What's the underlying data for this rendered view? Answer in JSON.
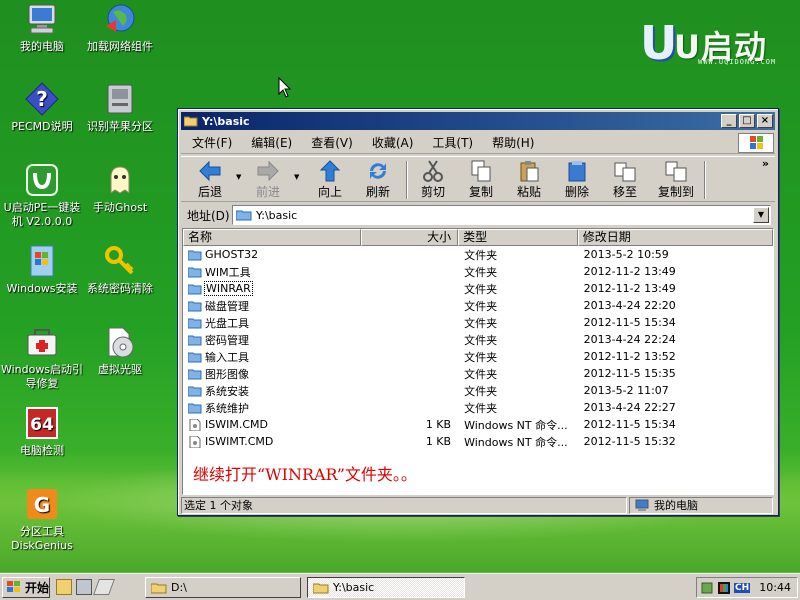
{
  "desktop": {
    "logo": {
      "brand": "U启动",
      "url": "WWW.UQIDONG.COM"
    },
    "icons": [
      {
        "label": "我的电脑",
        "glyph": "computer-icon"
      },
      {
        "label": "加载网络组件",
        "glyph": "network-globe-icon"
      },
      {
        "label": "PECMD说明",
        "glyph": "help-icon"
      },
      {
        "label": "识别苹果分区",
        "glyph": "disk-drive-icon"
      },
      {
        "label": "U启动PE一键装机 V2.0.0.0",
        "glyph": "uqidong-installer-icon"
      },
      {
        "label": "手动Ghost",
        "glyph": "ghost-icon"
      },
      {
        "label": "Windows安装",
        "glyph": "windows-setup-icon"
      },
      {
        "label": "系统密码清除",
        "glyph": "key-icon"
      },
      {
        "label": "Windows启动引导修复",
        "glyph": "boot-repair-icon"
      },
      {
        "label": "虚拟光驱",
        "glyph": "virtual-cd-icon"
      },
      {
        "label": "电脑检测",
        "glyph": "detect-64-icon"
      },
      {
        "label": "分区工具 DiskGenius",
        "glyph": "diskgenius-icon"
      }
    ]
  },
  "window": {
    "title": "Y:\\basic",
    "menu": [
      "文件(F)",
      "编辑(E)",
      "查看(V)",
      "收藏(A)",
      "工具(T)",
      "帮助(H)"
    ],
    "toolbar": {
      "back": "后退",
      "forward": "前进",
      "up": "向上",
      "refresh": "刷新",
      "cut": "剪切",
      "copy": "复制",
      "paste": "粘贴",
      "delete": "删除",
      "move_to": "移至",
      "copy_to": "复制到",
      "more": "»"
    },
    "address": {
      "label": "地址(D)",
      "value": "Y:\\basic"
    },
    "columns": {
      "name": "名称",
      "size": "大小",
      "type": "类型",
      "date": "修改日期"
    },
    "rows": [
      {
        "name": "GHOST32",
        "size": "",
        "type": "文件夹",
        "date": "2013-5-2 10:59",
        "kind": "folder"
      },
      {
        "name": "WIM工具",
        "size": "",
        "type": "文件夹",
        "date": "2012-11-2 13:49",
        "kind": "folder"
      },
      {
        "name": "WINRAR",
        "size": "",
        "type": "文件夹",
        "date": "2012-11-2 13:49",
        "kind": "folder"
      },
      {
        "name": "磁盘管理",
        "size": "",
        "type": "文件夹",
        "date": "2013-4-24 22:20",
        "kind": "folder"
      },
      {
        "name": "光盘工具",
        "size": "",
        "type": "文件夹",
        "date": "2012-11-5 15:34",
        "kind": "folder"
      },
      {
        "name": "密码管理",
        "size": "",
        "type": "文件夹",
        "date": "2013-4-24 22:24",
        "kind": "folder"
      },
      {
        "name": "输入工具",
        "size": "",
        "type": "文件夹",
        "date": "2012-11-2 13:52",
        "kind": "folder"
      },
      {
        "name": "图形图像",
        "size": "",
        "type": "文件夹",
        "date": "2012-11-5 15:35",
        "kind": "folder"
      },
      {
        "name": "系统安装",
        "size": "",
        "type": "文件夹",
        "date": "2013-5-2 11:07",
        "kind": "folder"
      },
      {
        "name": "系统维护",
        "size": "",
        "type": "文件夹",
        "date": "2013-4-24 22:27",
        "kind": "folder"
      },
      {
        "name": "ISWIM.CMD",
        "size": "1 KB",
        "type": "Windows NT 命令...",
        "date": "2012-11-5 15:34",
        "kind": "file"
      },
      {
        "name": "ISWIMT.CMD",
        "size": "1 KB",
        "type": "Windows NT 命令...",
        "date": "2012-11-5 15:32",
        "kind": "file"
      }
    ],
    "selected_row": "WINRAR",
    "instruction": "继续打开“WINRAR”文件夹。。",
    "status": {
      "selection": "选定 1 个对象",
      "location": "我的电脑"
    }
  },
  "taskbar": {
    "start_label": "开始",
    "tasks": [
      {
        "label": "D:\\",
        "active": false
      },
      {
        "label": "Y:\\basic",
        "active": true
      }
    ],
    "tray": {
      "lang": "CH",
      "time": "10:44"
    }
  },
  "colors": {
    "desktop_green": "#24a024",
    "title_blue": "#0a246a",
    "instruction_red": "#e00000",
    "selection_outline": "#000000"
  }
}
